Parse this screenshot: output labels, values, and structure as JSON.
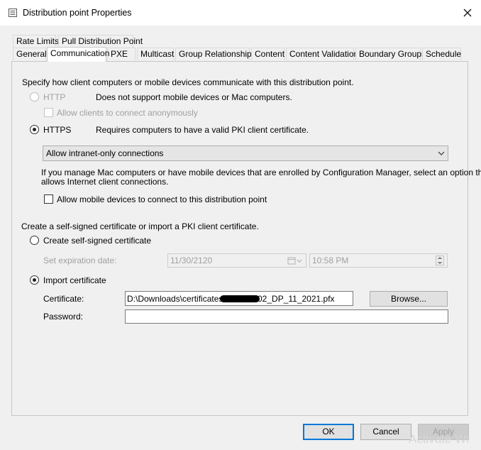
{
  "window": {
    "title": "Distribution point Properties"
  },
  "tabs_row1": [
    "Rate Limits",
    "Pull Distribution Point"
  ],
  "tabs_row2": [
    "General",
    "Communication",
    "PXE",
    "Multicast",
    "Group Relationships",
    "Content",
    "Content Validation",
    "Boundary Groups",
    "Schedule"
  ],
  "active_tab": "Communication",
  "comm": {
    "intro": "Specify how client computers or mobile devices communicate with this distribution point.",
    "http_label": "HTTP",
    "http_desc": "Does not support mobile devices or Mac computers.",
    "anon_label": "Allow clients to connect anonymously",
    "https_label": "HTTPS",
    "https_desc": "Requires computers to have a valid PKI client certificate.",
    "connection_value": "Allow intranet-only connections",
    "mac_note_1": "If you manage Mac computers or have mobile devices that are enrolled by Configuration Manager, select an option that",
    "mac_note_2": "allows Internet client connections.",
    "mobile_label": "Allow mobile devices to connect to this distribution point",
    "cert_intro": "Create a self-signed certificate or import a PKI client certificate.",
    "self_signed_label": "Create self-signed certificate",
    "expiration_label": "Set expiration date:",
    "expiration_date": "11/30/2120",
    "expiration_time": "10:58 PM",
    "import_label": "Import certificate",
    "certificate_label": "Certificate:",
    "certificate_prefix": "D:\\Downloads\\certificates\\",
    "certificate_suffix": "02_DP_11_2021.pfx",
    "browse_label": "Browse...",
    "password_label": "Password:",
    "password_value": ""
  },
  "buttons": {
    "ok": "OK",
    "cancel": "Cancel",
    "apply": "Apply"
  },
  "watermark": "Activate Wi",
  "state": {
    "http_selected": false,
    "https_selected": true,
    "self_signed_selected": false,
    "import_selected": true,
    "anon_checked": false,
    "mobile_checked": false
  }
}
